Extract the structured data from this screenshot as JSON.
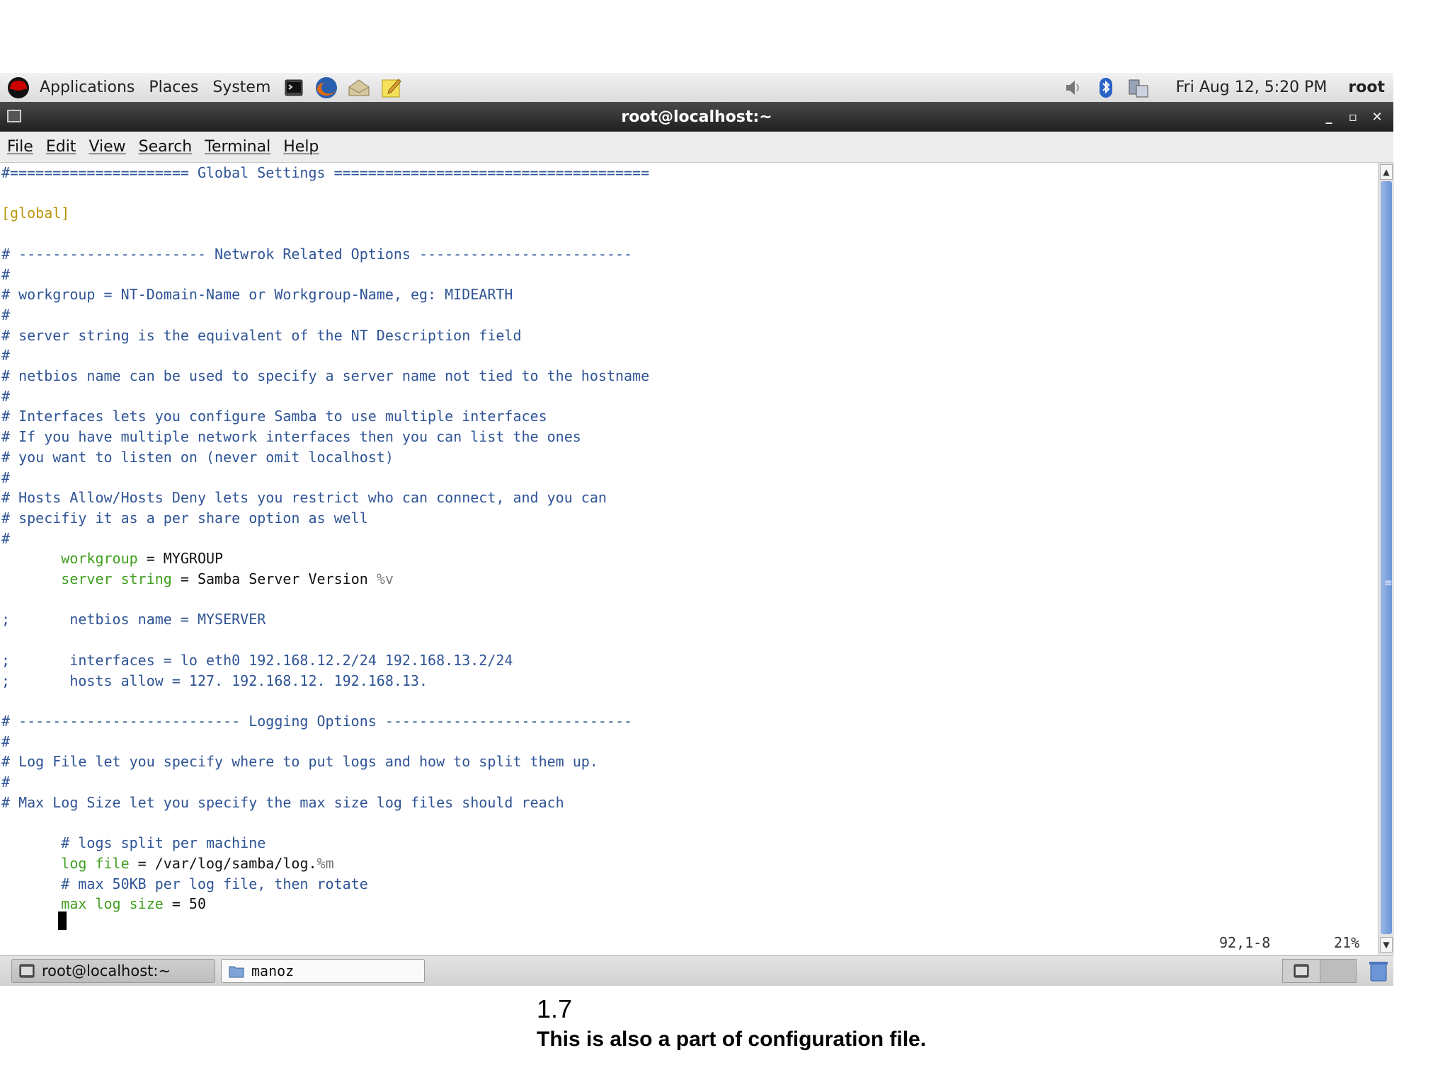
{
  "top_panel": {
    "menus": [
      "Applications",
      "Places",
      "System"
    ],
    "launchers": [
      "terminal-icon",
      "firefox-icon",
      "email-icon",
      "notes-icon"
    ],
    "tray": [
      "volume-icon",
      "bluetooth-icon",
      "network-icon"
    ],
    "clock": "Fri Aug 12,  5:20 PM",
    "user": "root"
  },
  "window": {
    "title": "root@localhost:~",
    "controls": [
      "minimize",
      "maximize",
      "close"
    ],
    "minimize_glyph": "_",
    "maximize_glyph": "▫",
    "close_glyph": "✕"
  },
  "menubar": [
    "File",
    "Edit",
    "View",
    "Search",
    "Terminal",
    "Help"
  ],
  "terminal": {
    "lines": [
      {
        "text": "#===================== Global Settings =====================================",
        "style": "comment"
      },
      {
        "text": "",
        "style": "comment"
      },
      {
        "text": "[global]",
        "style": "yellow"
      },
      {
        "text": "",
        "style": "comment"
      },
      {
        "text": "# ---------------------- Netwrok Related Options -------------------------",
        "style": "comment"
      },
      {
        "text": "#",
        "style": "comment"
      },
      {
        "text": "# workgroup = NT-Domain-Name or Workgroup-Name, eg: MIDEARTH",
        "style": "comment"
      },
      {
        "text": "#",
        "style": "comment"
      },
      {
        "text": "# server string is the equivalent of the NT Description field",
        "style": "comment"
      },
      {
        "text": "#",
        "style": "comment"
      },
      {
        "text": "# netbios name can be used to specify a server name not tied to the hostname",
        "style": "comment"
      },
      {
        "text": "#",
        "style": "comment"
      },
      {
        "text": "# Interfaces lets you configure Samba to use multiple interfaces",
        "style": "comment"
      },
      {
        "text": "# If you have multiple network interfaces then you can list the ones",
        "style": "comment"
      },
      {
        "text": "# you want to listen on (never omit localhost)",
        "style": "comment"
      },
      {
        "text": "#",
        "style": "comment"
      },
      {
        "text": "# Hosts Allow/Hosts Deny lets you restrict who can connect, and you can",
        "style": "comment"
      },
      {
        "text": "# specifiy it as a per share option as well",
        "style": "comment"
      },
      {
        "text": "#",
        "style": "comment"
      },
      {
        "text": "",
        "style": "setting",
        "indent": "       ",
        "key": "workgroup",
        "value": " = MYGROUP",
        "extra": ""
      },
      {
        "text": "",
        "style": "setting",
        "indent": "       ",
        "key": "server string",
        "value": " = Samba Server Version ",
        "extra": "%v"
      },
      {
        "text": "",
        "style": "comment"
      },
      {
        "text": ";       netbios name = MYSERVER",
        "style": "comment"
      },
      {
        "text": "",
        "style": "comment"
      },
      {
        "text": ";       interfaces = lo eth0 192.168.12.2/24 192.168.13.2/24",
        "style": "comment"
      },
      {
        "text": ";       hosts allow = 127. 192.168.12. 192.168.13.",
        "style": "comment"
      },
      {
        "text": "",
        "style": "comment"
      },
      {
        "text": "# -------------------------- Logging Options -----------------------------",
        "style": "comment"
      },
      {
        "text": "#",
        "style": "comment"
      },
      {
        "text": "# Log File let you specify where to put logs and how to split them up.",
        "style": "comment"
      },
      {
        "text": "#",
        "style": "comment"
      },
      {
        "text": "# Max Log Size let you specify the max size log files should reach",
        "style": "comment"
      },
      {
        "text": "",
        "style": "comment"
      },
      {
        "text": "       # logs split per machine",
        "style": "comment"
      },
      {
        "text": "",
        "style": "setting",
        "indent": "       ",
        "key": "log file",
        "value": " = /var/log/samba/log.",
        "extra": "%m"
      },
      {
        "text": "       # max 50KB per log file, then rotate",
        "style": "comment"
      },
      {
        "text": "",
        "style": "setting",
        "indent": "       ",
        "key": "max log size",
        "value": " = 50",
        "extra": ""
      }
    ],
    "cursor_position": "92,1-8",
    "scroll_percent": "21%"
  },
  "scrollbar": {
    "up": "▲",
    "down": "▼",
    "grip": "≡"
  },
  "taskbar": {
    "tasks": [
      {
        "label": "root@localhost:~",
        "active": true
      },
      {
        "label": "manoz",
        "active": false
      }
    ]
  },
  "caption": {
    "number": "1.7",
    "text": "This is also a part of configuration file."
  }
}
